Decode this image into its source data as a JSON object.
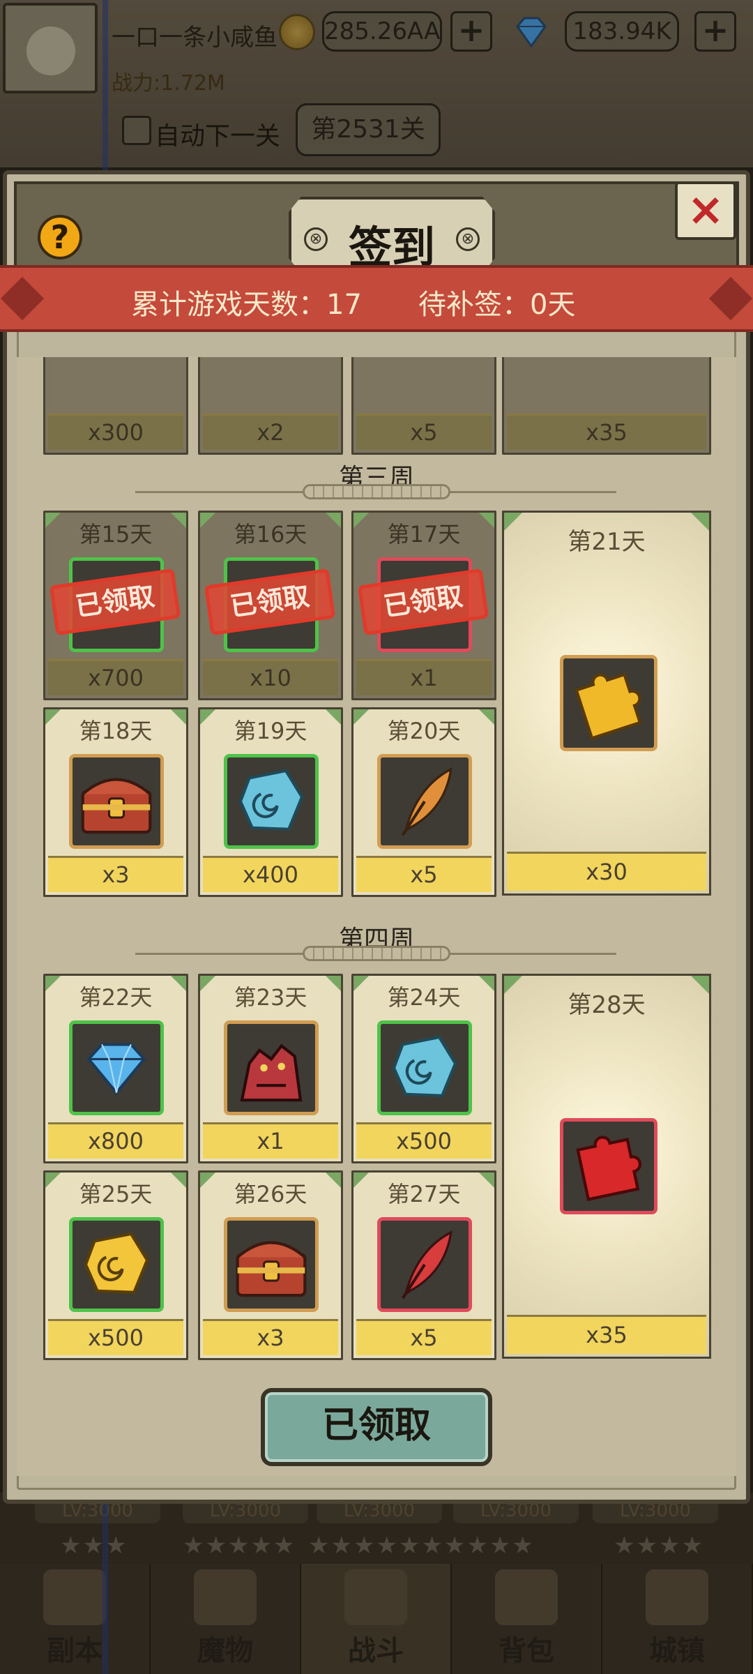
{
  "top_bar": {
    "player_name": "一口一条小咸鱼",
    "coins": "285.26AA",
    "gems": "183.94K",
    "coins_plus": "+",
    "gems_plus": "+",
    "power": "战力:1.72M",
    "auto_next_label": "自动下一关",
    "level": "第2531关"
  },
  "background_bottom": {
    "levels": [
      "LV:3000",
      "LV:3000",
      "LV:3000",
      "LV:3000",
      "LV:3000"
    ],
    "stars": [
      "★★★",
      "★★★★★",
      "★★★★★★★★★★",
      "★★★★"
    ]
  },
  "nav": [
    {
      "label": "副本",
      "icon": "dungeon-icon"
    },
    {
      "label": "魔物",
      "icon": "monster-icon"
    },
    {
      "label": "战斗",
      "icon": "swords-icon"
    },
    {
      "label": "背包",
      "icon": "backpack-icon"
    },
    {
      "label": "城镇",
      "icon": "town-icon"
    }
  ],
  "modal": {
    "title": "签到",
    "help": "?",
    "close": "×",
    "total_days_text": "累计游戏天数：17",
    "makeup_text": "待补签：0天",
    "claim_button": "已领取",
    "stamp_text": "已领取",
    "week2_partial": {
      "quantities": [
        "x300",
        "x2",
        "x5",
        "x35"
      ]
    },
    "week3": {
      "title": "第三周",
      "days": [
        {
          "day": "第15天",
          "qty": "x700",
          "claimed": true,
          "frame": "green",
          "icon": "gem-icon"
        },
        {
          "day": "第16天",
          "qty": "x10",
          "claimed": true,
          "frame": "green",
          "icon": "scroll-icon"
        },
        {
          "day": "第17天",
          "qty": "x1",
          "claimed": true,
          "frame": "red",
          "icon": "monster-card-icon"
        },
        {
          "day": "第18天",
          "qty": "x3",
          "claimed": false,
          "frame": "orange",
          "icon": "treasure-chest-icon"
        },
        {
          "day": "第19天",
          "qty": "x400",
          "claimed": false,
          "frame": "green",
          "icon": "blue-ore-icon"
        },
        {
          "day": "第20天",
          "qty": "x5",
          "claimed": false,
          "frame": "orange",
          "icon": "orange-feather-icon"
        }
      ],
      "big": {
        "day": "第21天",
        "qty": "x30",
        "frame": "orange",
        "icon": "gold-puzzle-icon"
      }
    },
    "week4": {
      "title": "第四周",
      "days": [
        {
          "day": "第22天",
          "qty": "x800",
          "claimed": false,
          "frame": "green",
          "icon": "diamond-icon"
        },
        {
          "day": "第23天",
          "qty": "x1",
          "claimed": false,
          "frame": "orange",
          "icon": "red-demon-icon"
        },
        {
          "day": "第24天",
          "qty": "x500",
          "claimed": false,
          "frame": "green",
          "icon": "blue-ore-icon"
        },
        {
          "day": "第25天",
          "qty": "x500",
          "claimed": false,
          "frame": "green",
          "icon": "gold-ore-icon"
        },
        {
          "day": "第26天",
          "qty": "x3",
          "claimed": false,
          "frame": "orange",
          "icon": "treasure-chest-icon"
        },
        {
          "day": "第27天",
          "qty": "x5",
          "claimed": false,
          "frame": "red",
          "icon": "red-feather-icon"
        }
      ],
      "big": {
        "day": "第28天",
        "qty": "x35",
        "frame": "red",
        "icon": "red-puzzle-icon"
      }
    }
  },
  "colors": {
    "ribbon": "#c44a3c",
    "qty_bar": "#f2d55c",
    "frame_green": "#4fc24a",
    "frame_red": "#e04a5a",
    "frame_orange": "#d19d52",
    "stamp": "#e03a2a",
    "claim_button": "#7aa89a"
  }
}
